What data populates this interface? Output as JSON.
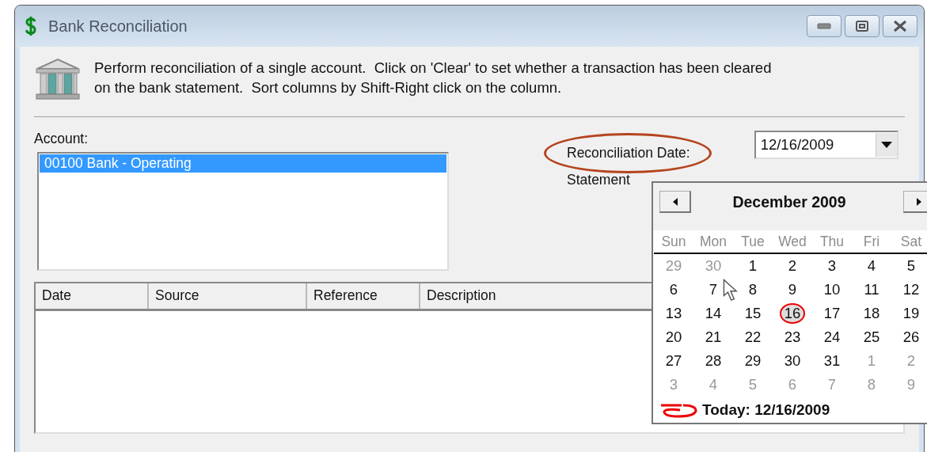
{
  "window": {
    "title": "Bank Reconciliation"
  },
  "description": "Perform reconciliation of a single account.  Click on 'Clear' to set whether a transaction has been cleared on the bank statement.  Sort columns by Shift-Right click on the column.",
  "account_label": "Account:",
  "accounts": [
    {
      "label": "00100 Bank - Operating",
      "selected": true
    }
  ],
  "reconciliation_date": {
    "label": "Reconciliation Date:",
    "circled": true,
    "value": "12/16/2009"
  },
  "statement_label": "Statement",
  "table": {
    "columns": [
      "Date",
      "Source",
      "Reference",
      "Description"
    ]
  },
  "calendar": {
    "title": "December 2009",
    "weekdays": [
      "Sun",
      "Mon",
      "Tue",
      "Wed",
      "Thu",
      "Fri",
      "Sat"
    ],
    "weeks": [
      [
        {
          "day": "29",
          "other_month": true,
          "selected": false,
          "circled": false
        },
        {
          "day": "30",
          "other_month": true,
          "selected": false,
          "circled": false
        },
        {
          "day": "1",
          "other_month": false,
          "selected": false,
          "circled": false
        },
        {
          "day": "2",
          "other_month": false,
          "selected": false,
          "circled": false
        },
        {
          "day": "3",
          "other_month": false,
          "selected": false,
          "circled": false
        },
        {
          "day": "4",
          "other_month": false,
          "selected": false,
          "circled": false
        },
        {
          "day": "5",
          "other_month": false,
          "selected": false,
          "circled": false
        }
      ],
      [
        {
          "day": "6",
          "other_month": false,
          "selected": false,
          "circled": false
        },
        {
          "day": "7",
          "other_month": false,
          "selected": false,
          "circled": false
        },
        {
          "day": "8",
          "other_month": false,
          "selected": false,
          "circled": false
        },
        {
          "day": "9",
          "other_month": false,
          "selected": false,
          "circled": false
        },
        {
          "day": "10",
          "other_month": false,
          "selected": false,
          "circled": false
        },
        {
          "day": "11",
          "other_month": false,
          "selected": false,
          "circled": false
        },
        {
          "day": "12",
          "other_month": false,
          "selected": false,
          "circled": false
        }
      ],
      [
        {
          "day": "13",
          "other_month": false,
          "selected": false,
          "circled": false
        },
        {
          "day": "14",
          "other_month": false,
          "selected": false,
          "circled": false
        },
        {
          "day": "15",
          "other_month": false,
          "selected": false,
          "circled": false
        },
        {
          "day": "16",
          "other_month": false,
          "selected": true,
          "circled": true
        },
        {
          "day": "17",
          "other_month": false,
          "selected": false,
          "circled": false
        },
        {
          "day": "18",
          "other_month": false,
          "selected": false,
          "circled": false
        },
        {
          "day": "19",
          "other_month": false,
          "selected": false,
          "circled": false
        }
      ],
      [
        {
          "day": "20",
          "other_month": false,
          "selected": false,
          "circled": false
        },
        {
          "day": "21",
          "other_month": false,
          "selected": false,
          "circled": false
        },
        {
          "day": "22",
          "other_month": false,
          "selected": false,
          "circled": false
        },
        {
          "day": "23",
          "other_month": false,
          "selected": false,
          "circled": false
        },
        {
          "day": "24",
          "other_month": false,
          "selected": false,
          "circled": false
        },
        {
          "day": "25",
          "other_month": false,
          "selected": false,
          "circled": false
        },
        {
          "day": "26",
          "other_month": false,
          "selected": false,
          "circled": false
        }
      ],
      [
        {
          "day": "27",
          "other_month": false,
          "selected": false,
          "circled": false
        },
        {
          "day": "28",
          "other_month": false,
          "selected": false,
          "circled": false
        },
        {
          "day": "29",
          "other_month": false,
          "selected": false,
          "circled": false
        },
        {
          "day": "30",
          "other_month": false,
          "selected": false,
          "circled": false
        },
        {
          "day": "31",
          "other_month": false,
          "selected": false,
          "circled": false
        },
        {
          "day": "1",
          "other_month": true,
          "selected": false,
          "circled": false
        },
        {
          "day": "2",
          "other_month": true,
          "selected": false,
          "circled": false
        }
      ],
      [
        {
          "day": "3",
          "other_month": true,
          "selected": false,
          "circled": false
        },
        {
          "day": "4",
          "other_month": true,
          "selected": false,
          "circled": false
        },
        {
          "day": "5",
          "other_month": true,
          "selected": false,
          "circled": false
        },
        {
          "day": "6",
          "other_month": true,
          "selected": false,
          "circled": false
        },
        {
          "day": "7",
          "other_month": true,
          "selected": false,
          "circled": false
        },
        {
          "day": "8",
          "other_month": true,
          "selected": false,
          "circled": false
        },
        {
          "day": "9",
          "other_month": true,
          "selected": false,
          "circled": false
        }
      ]
    ],
    "today": "Today: 12/16/2009"
  }
}
